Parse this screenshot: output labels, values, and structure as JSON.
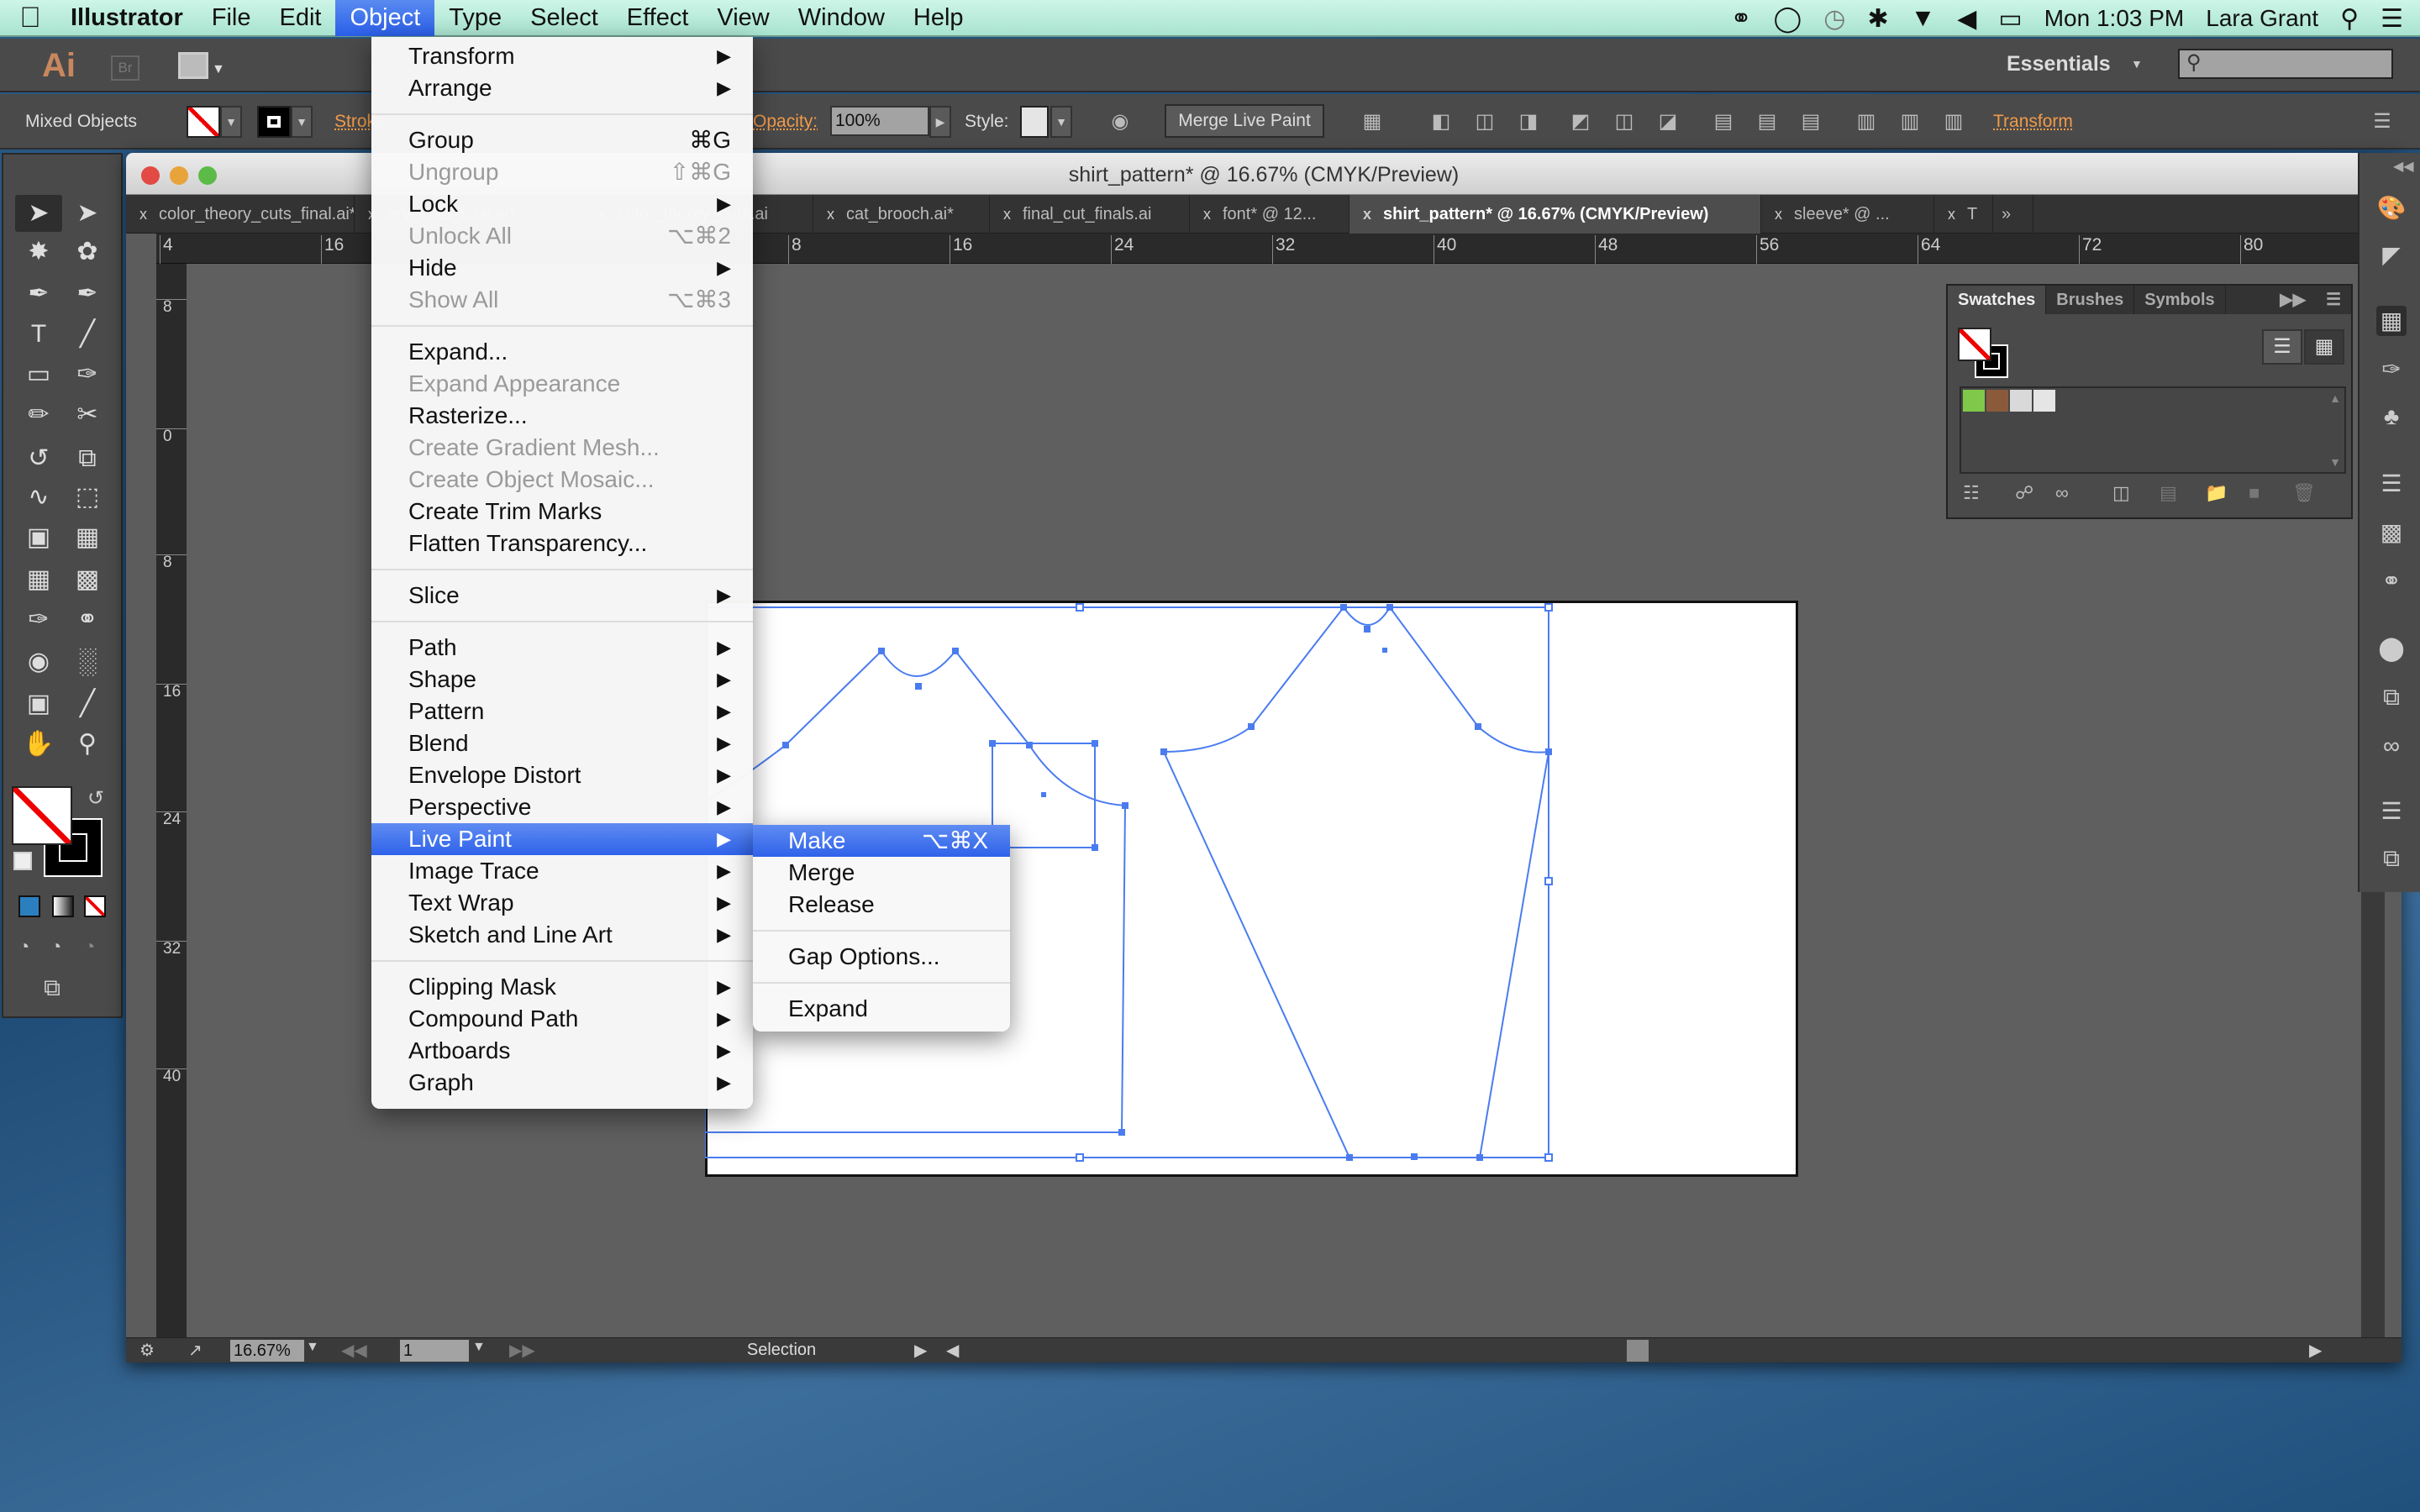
{
  "menubar": {
    "apple": "",
    "app_name": "Illustrator",
    "items": [
      "File",
      "Edit",
      "Object",
      "Type",
      "Select",
      "Effect",
      "View",
      "Window",
      "Help"
    ],
    "active": "Object",
    "status": {
      "clock": "Mon 1:03 PM",
      "user": "Lara Grant"
    }
  },
  "appbar": {
    "ai_logo": "Ai",
    "br_logo": "Br",
    "workspace": "Essentials",
    "search_placeholder": ""
  },
  "controlbar": {
    "selection_type": "Mixed Objects",
    "stroke_label": "Stroke",
    "opacity_label": "Opacity:",
    "opacity_value": "100%",
    "style_label": "Style:",
    "merge_button": "Merge Live Paint",
    "transform_link": "Transform"
  },
  "document": {
    "title": "shirt_pattern* @ 16.67% (CMYK/Preview)",
    "tabs": [
      {
        "label": "color_theory_cuts_final.ai*",
        "active": false
      },
      {
        "label": "ory_cuts_final.ai*",
        "active": false
      },
      {
        "label": "color_theory_cuts.ai",
        "active": false
      },
      {
        "label": "cat_brooch.ai*",
        "active": false
      },
      {
        "label": "final_cut_finals.ai",
        "active": false
      },
      {
        "label": "font* @ 12...",
        "active": false
      },
      {
        "label": "shirt_pattern* @ 16.67% (CMYK/Preview)",
        "active": true
      },
      {
        "label": "sleeve* @ ...",
        "active": false
      },
      {
        "label": "T",
        "active": false
      }
    ],
    "hruler_ticks": [
      "4",
      "16",
      "8",
      "16",
      "24",
      "32",
      "40",
      "48",
      "56",
      "64",
      "72",
      "80"
    ],
    "vruler_ticks": [
      "8",
      "0",
      "8",
      "16",
      "24",
      "32",
      "40"
    ],
    "status": {
      "zoom": "16.67%",
      "page": "1",
      "tool": "Selection"
    }
  },
  "swatches_panel": {
    "tabs": [
      "Swatches",
      "Brushes",
      "Symbols"
    ],
    "active_tab": "Swatches",
    "swatch_colors": [
      "#7fc84a",
      "#8b5a3a",
      "#d9d9d9",
      "#e5e5e5"
    ]
  },
  "object_menu": {
    "items": [
      {
        "label": "Transform",
        "submenu": true
      },
      {
        "label": "Arrange",
        "submenu": true
      },
      {
        "sep": true
      },
      {
        "label": "Group",
        "shortcut": "⌘G"
      },
      {
        "label": "Ungroup",
        "shortcut": "⇧⌘G",
        "disabled": true
      },
      {
        "label": "Lock",
        "submenu": true
      },
      {
        "label": "Unlock All",
        "shortcut": "⌥⌘2",
        "disabled": true
      },
      {
        "label": "Hide",
        "submenu": true
      },
      {
        "label": "Show All",
        "shortcut": "⌥⌘3",
        "disabled": true
      },
      {
        "sep": true
      },
      {
        "label": "Expand..."
      },
      {
        "label": "Expand Appearance",
        "disabled": true
      },
      {
        "label": "Rasterize..."
      },
      {
        "label": "Create Gradient Mesh...",
        "disabled": true
      },
      {
        "label": "Create Object Mosaic...",
        "disabled": true
      },
      {
        "label": "Create Trim Marks"
      },
      {
        "label": "Flatten Transparency..."
      },
      {
        "sep": true
      },
      {
        "label": "Slice",
        "submenu": true
      },
      {
        "sep": true
      },
      {
        "label": "Path",
        "submenu": true
      },
      {
        "label": "Shape",
        "submenu": true
      },
      {
        "label": "Pattern",
        "submenu": true
      },
      {
        "label": "Blend",
        "submenu": true
      },
      {
        "label": "Envelope Distort",
        "submenu": true
      },
      {
        "label": "Perspective",
        "submenu": true
      },
      {
        "label": "Live Paint",
        "submenu": true,
        "highlighted": true
      },
      {
        "label": "Image Trace",
        "submenu": true
      },
      {
        "label": "Text Wrap",
        "submenu": true
      },
      {
        "label": "Sketch and Line Art",
        "submenu": true
      },
      {
        "sep": true
      },
      {
        "label": "Clipping Mask",
        "submenu": true
      },
      {
        "label": "Compound Path",
        "submenu": true
      },
      {
        "label": "Artboards",
        "submenu": true
      },
      {
        "label": "Graph",
        "submenu": true
      }
    ]
  },
  "live_paint_submenu": {
    "items": [
      {
        "label": "Make",
        "shortcut": "⌥⌘X",
        "highlighted": true
      },
      {
        "label": "Merge"
      },
      {
        "label": "Release"
      },
      {
        "sep": true
      },
      {
        "label": "Gap Options..."
      },
      {
        "sep": true
      },
      {
        "label": "Expand"
      }
    ]
  },
  "colors": {
    "accent": "#2f62ea",
    "selection_path": "#4a7cf0",
    "orange_link": "#f19b49"
  }
}
